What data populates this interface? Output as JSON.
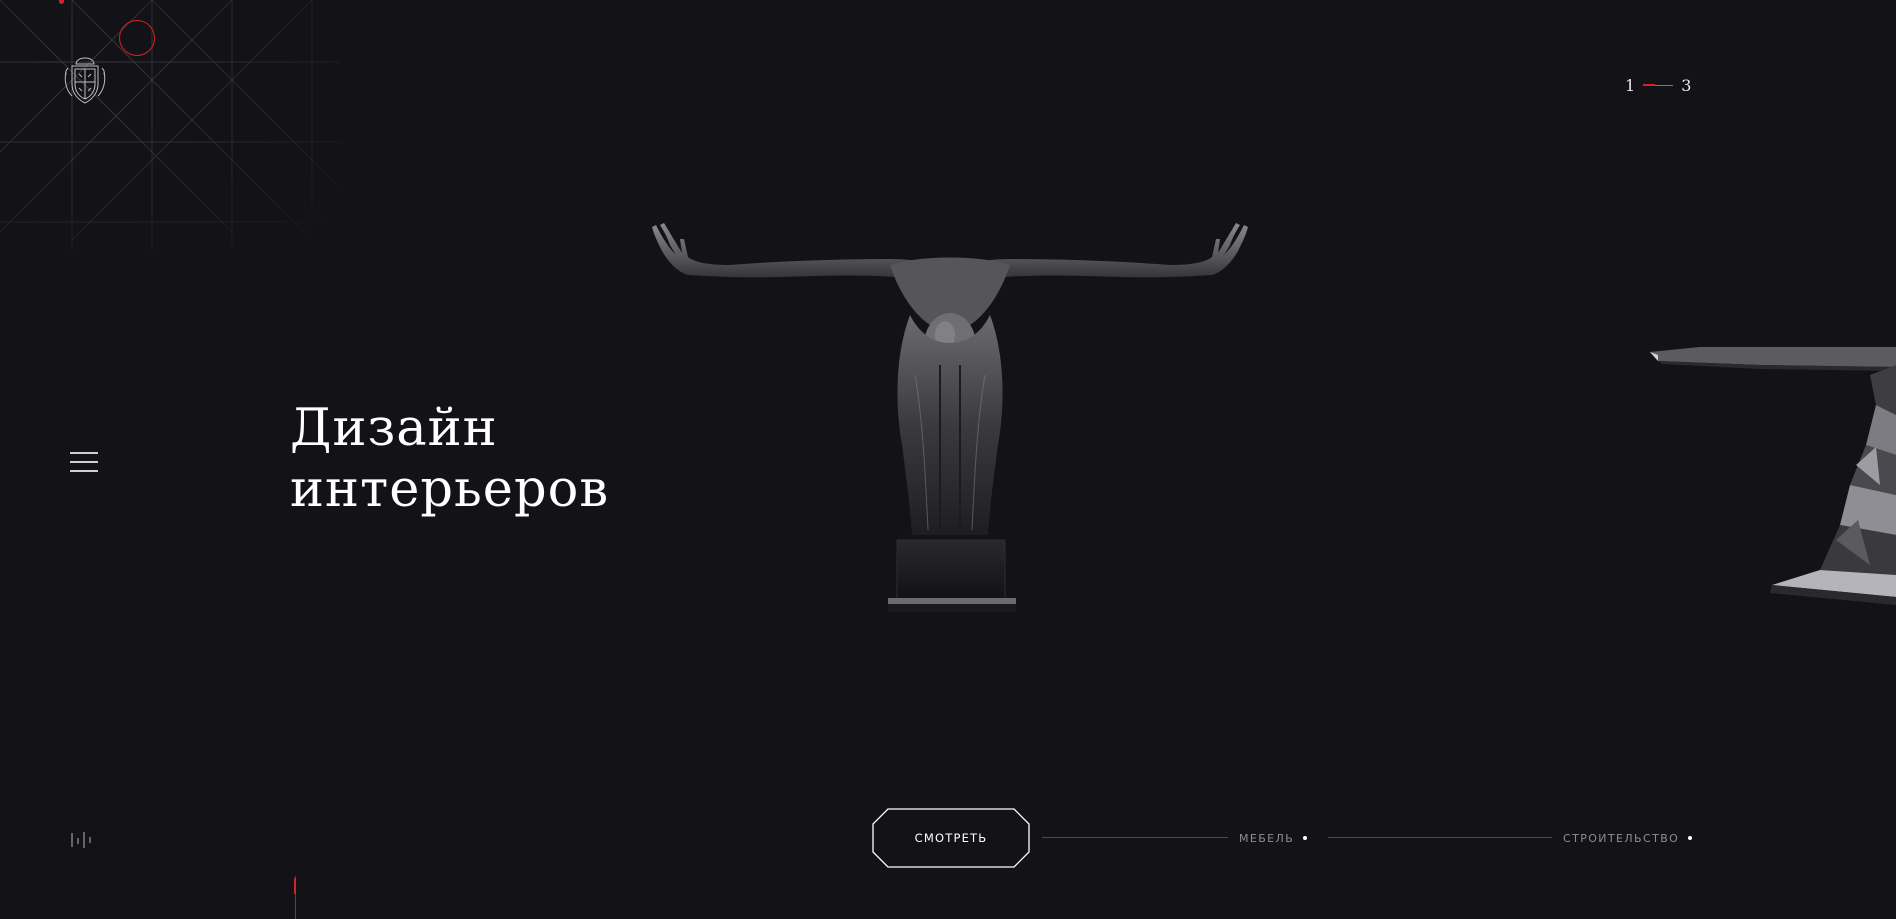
{
  "slide_counter": {
    "current": "1",
    "total": "3"
  },
  "hero": {
    "title_line_1": "Дизайн",
    "title_line_2": "интерьеров"
  },
  "actions": {
    "watch_label": "СМОТРЕТЬ"
  },
  "nav": {
    "links": [
      {
        "label": "МЕБЕЛЬ"
      },
      {
        "label": "СТРОИТЕЛЬСТВО"
      }
    ]
  },
  "icons": {
    "logo": "crest-logo-icon",
    "menu": "hamburger-menu-icon",
    "sound": "sound-wave-icon"
  },
  "colors": {
    "background": "#131217",
    "accent": "#d6202b",
    "text": "#ffffff",
    "muted": "#8d8d94"
  }
}
